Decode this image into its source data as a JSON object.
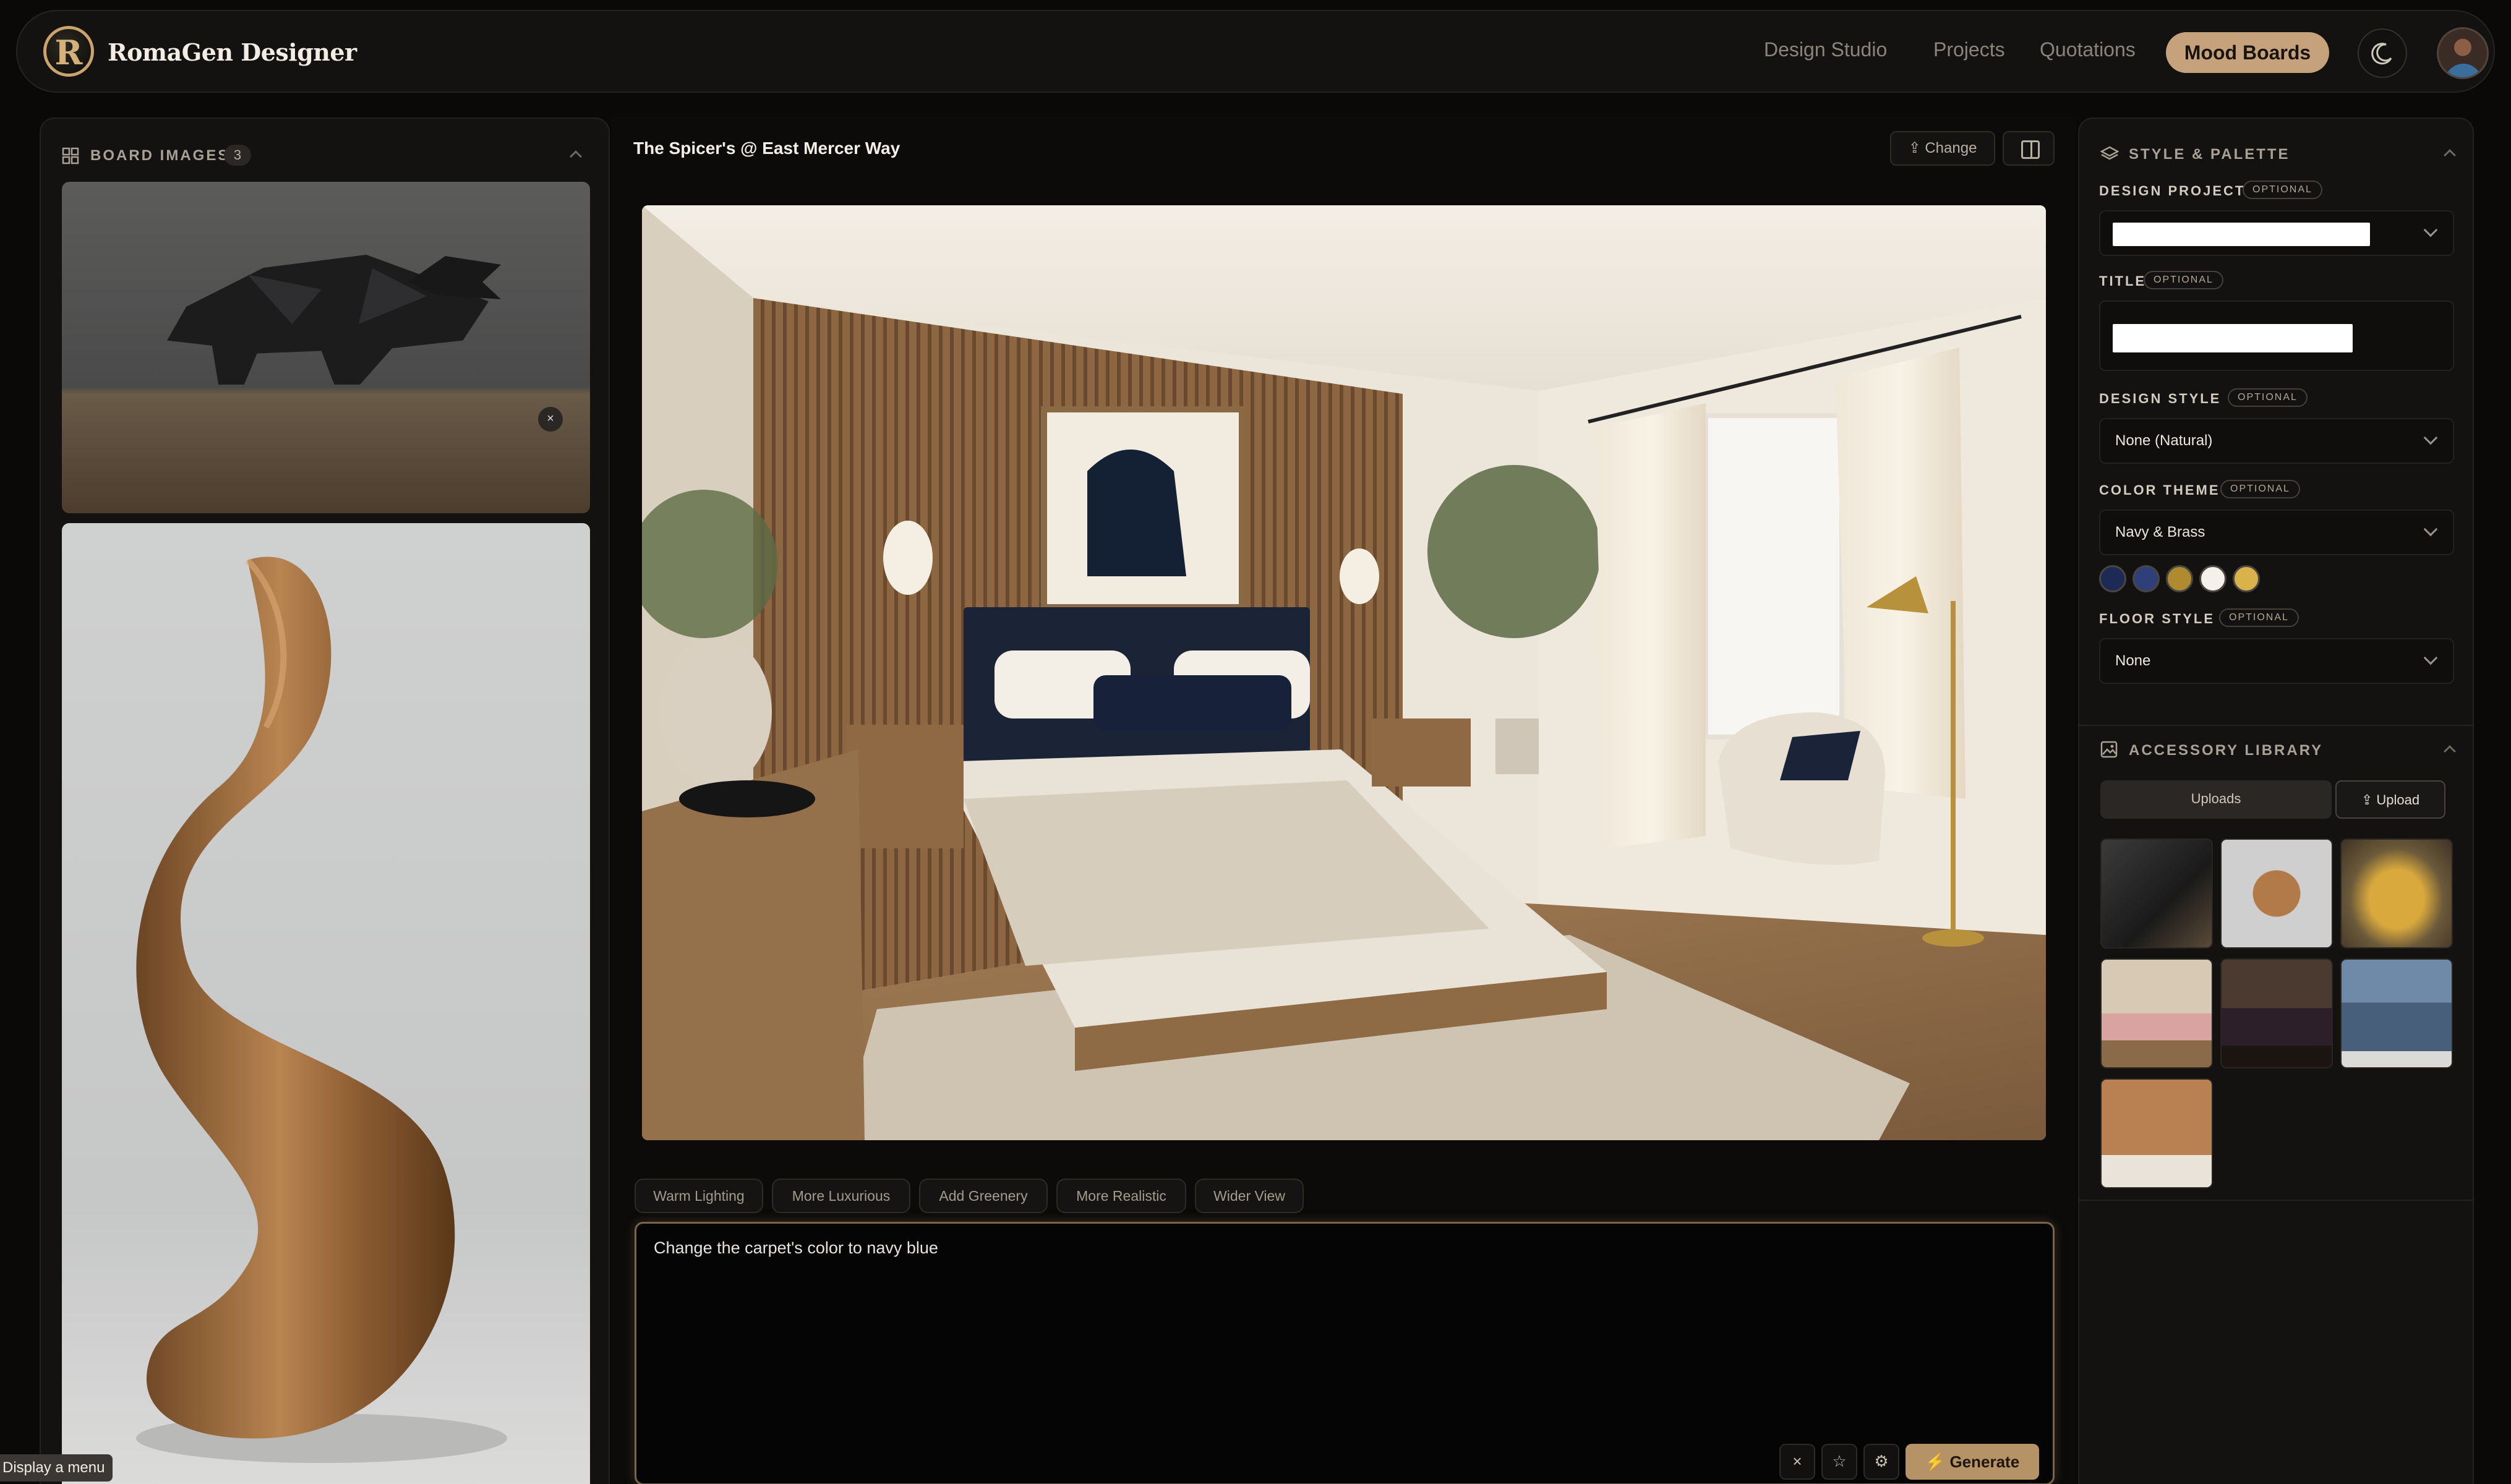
{
  "brand": {
    "name": "RomaGen Designer",
    "logo_letter": "R"
  },
  "nav": {
    "items": [
      "Design Studio",
      "Projects",
      "Quotations"
    ],
    "active": "Mood Boards"
  },
  "left_panel": {
    "title": "BOARD IMAGES",
    "count": "3",
    "images": [
      "geometric-bull-sculpture",
      "wooden-wave-sculpture"
    ]
  },
  "tooltip": "Display a menu",
  "center": {
    "board_title": "The Spicer's @ East Mercer Way",
    "change_label": "Change",
    "chips": [
      "Warm Lighting",
      "More Luxurious",
      "Add Greenery",
      "More Realistic",
      "Wider View"
    ],
    "prompt": "Change the carpet's color to navy blue",
    "generate_label": "Generate"
  },
  "style_palette": {
    "title": "STYLE & PALETTE",
    "optional": "OPTIONAL",
    "design_project_label": "DESIGN PROJECT",
    "title_label": "TITLE",
    "design_style_label": "DESIGN STYLE",
    "design_style_value": "None (Natural)",
    "color_theme_label": "COLOR THEME",
    "color_theme_value": "Navy & Brass",
    "swatches": [
      "#1c2a55",
      "#2e3f7a",
      "#b08a2e",
      "#f4f1ea",
      "#d9b24c"
    ],
    "floor_style_label": "FLOOR STYLE",
    "floor_style_value": "None"
  },
  "accessory_library": {
    "title": "ACCESSORY LIBRARY",
    "uploads_tab": "Uploads",
    "upload_button": "Upload",
    "thumbnails": [
      "black-bull",
      "wood-wave",
      "gold-bull",
      "pink-bedroom",
      "dark-bedroom",
      "blue-sofa",
      "wood-texture"
    ]
  },
  "colors": {
    "accent": "#c5a27c",
    "background": "#0a0908",
    "panel": "#131211"
  }
}
